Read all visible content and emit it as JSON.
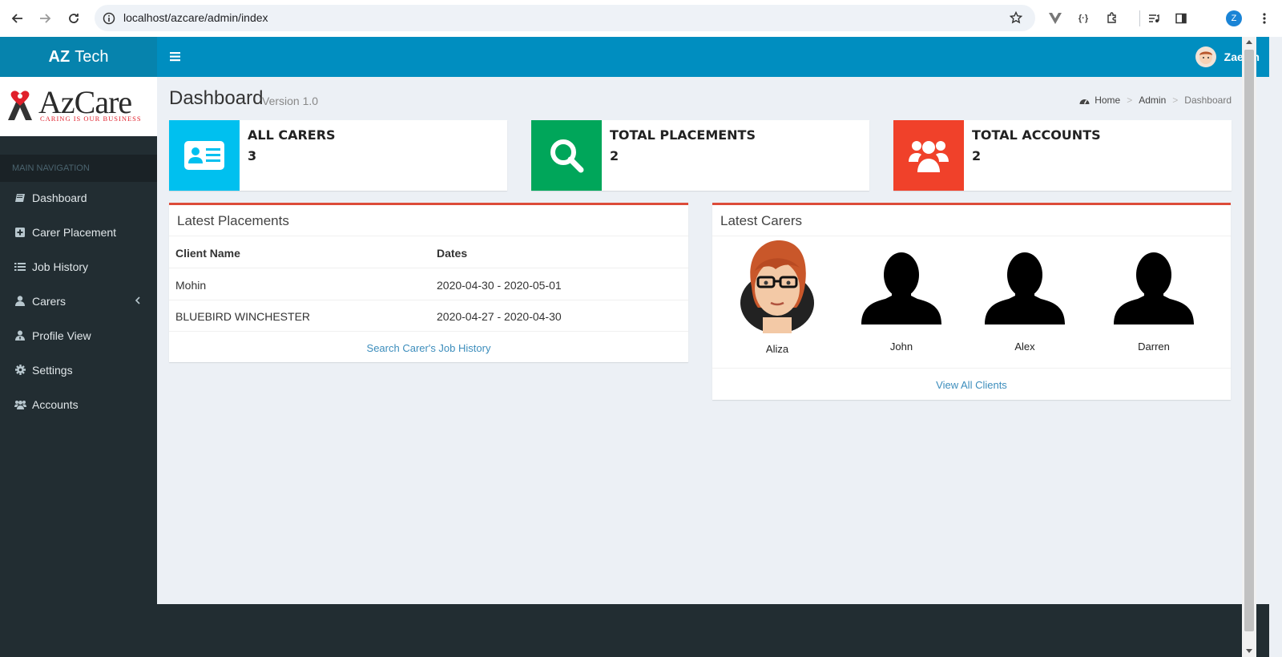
{
  "browser": {
    "url": "localhost/azcare/admin/index",
    "profile_initial": "Z"
  },
  "header": {
    "logo_bold": "AZ",
    "logo_rest": "Tech",
    "user_name": "Zaeem"
  },
  "sidebar": {
    "brand_name": "AzCare",
    "brand_tagline": "CARING IS OUR BUSINESS",
    "nav_header": "MAIN NAVIGATION",
    "items": [
      {
        "label": "Dashboard",
        "icon": "book-icon"
      },
      {
        "label": "Carer Placement",
        "icon": "plus-square-icon"
      },
      {
        "label": "Job History",
        "icon": "list-icon"
      },
      {
        "label": "Carers",
        "icon": "user-icon"
      },
      {
        "label": "Profile View",
        "icon": "user-tie-icon"
      },
      {
        "label": "Settings",
        "icon": "gear-icon"
      },
      {
        "label": "Accounts",
        "icon": "users-icon"
      }
    ]
  },
  "page": {
    "title": "Dashboard",
    "subtitle": "Version 1.0",
    "breadcrumb": [
      "Home",
      "Admin",
      "Dashboard"
    ]
  },
  "info_boxes": [
    {
      "label": "ALL CARERS",
      "value": "3",
      "color": "#00c0ef",
      "icon": "id-card-icon"
    },
    {
      "label": "TOTAL PLACEMENTS",
      "value": "2",
      "color": "#00a65a",
      "icon": "search-icon"
    },
    {
      "label": "TOTAL ACCOUNTS",
      "value": "2",
      "color": "#dd4b39",
      "icon": "users-icon"
    }
  ],
  "placements": {
    "title": "Latest Placements",
    "columns": [
      "Client Name",
      "Dates"
    ],
    "rows": [
      [
        "Mohin",
        "2020-04-30 - 2020-05-01"
      ],
      [
        "BLUEBIRD WINCHESTER",
        "2020-04-27 - 2020-04-30"
      ]
    ],
    "link": "Search Carer's Job History"
  },
  "carers": {
    "title": "Latest Carers",
    "people": [
      "Aliza",
      "John",
      "Alex",
      "Darren"
    ],
    "link": "View All Clients"
  },
  "colors": {
    "header": "#008ec0",
    "sidebar": "#222d32",
    "box_accent": "#dd4b39",
    "link": "#3c8dbc"
  }
}
